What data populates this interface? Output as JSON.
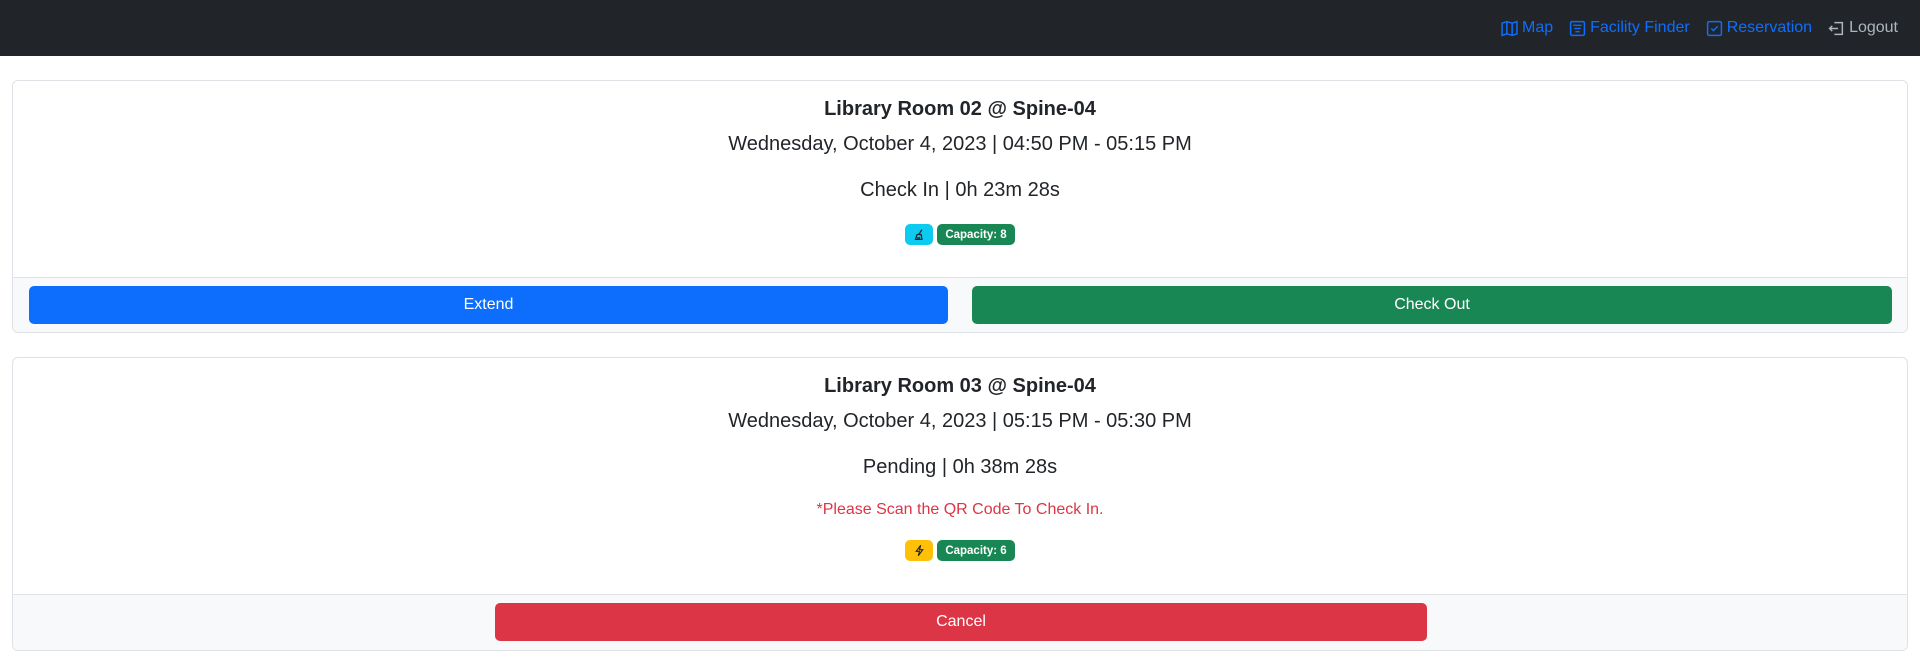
{
  "nav": {
    "map": "Map",
    "facility_finder": "Facility Finder",
    "reservation": "Reservation",
    "logout": "Logout"
  },
  "reservations": [
    {
      "title": "Library Room 02 @ Spine-04",
      "datetime": "Wednesday, October 4, 2023 | 04:50 PM - 05:15 PM",
      "status": "Check In | 0h 23m 28s",
      "icon_badge": "broom-icon",
      "capacity": "Capacity: 8",
      "extend_label": "Extend",
      "checkout_label": "Check Out"
    },
    {
      "title": "Library Room 03 @ Spine-04",
      "datetime": "Wednesday, October 4, 2023 | 05:15 PM - 05:30 PM",
      "status": "Pending | 0h 38m 28s",
      "notice": "*Please Scan the QR Code To Check In.",
      "icon_badge": "lightning-icon",
      "capacity": "Capacity: 6",
      "cancel_label": "Cancel"
    }
  ],
  "colors": {
    "navbar": "#212529",
    "primary": "#0d6efd",
    "success": "#198754",
    "danger": "#dc3545",
    "info": "#0dcaf0",
    "warning": "#ffc107"
  }
}
